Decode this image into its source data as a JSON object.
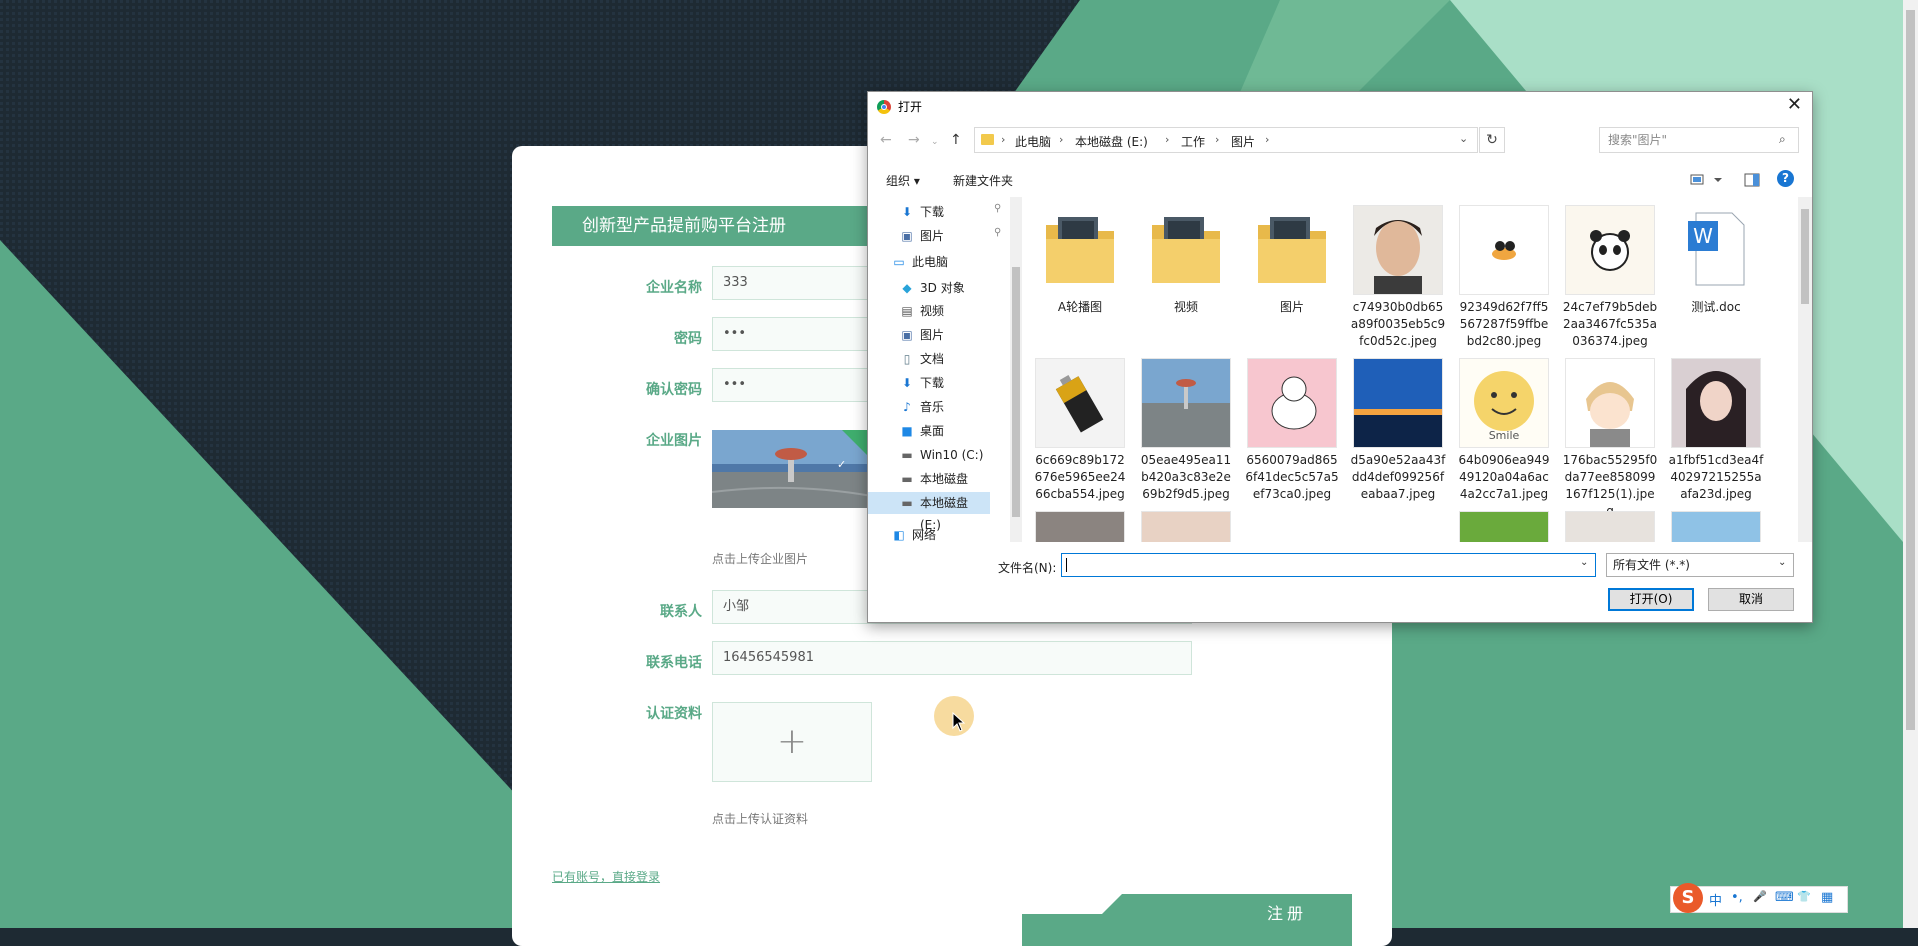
{
  "registration": {
    "title": "创新型产品提前购平台注册",
    "fields": [
      {
        "label": "企业名称",
        "value": "333"
      },
      {
        "label": "密码",
        "value": "•••"
      },
      {
        "label": "确认密码",
        "value": "•••"
      }
    ],
    "image_label": "企业图片",
    "image_hint": "点击上传企业图片",
    "contact_label": "联系人",
    "contact_value": "小邹",
    "phone_label": "联系电话",
    "phone_value": "16456545981",
    "cert_label": "认证资料",
    "cert_plus": "+",
    "cert_hint": "点击上传认证资料",
    "login_link": "已有账号，直接登录",
    "register_button": "注册"
  },
  "dialog": {
    "title": "打开",
    "close": "✕",
    "breadcrumbs": [
      "此电脑",
      "本地磁盘 (E:)",
      "工作",
      "图片"
    ],
    "search_placeholder": "搜索\"图片\"",
    "organize": "组织 ▾",
    "new_folder": "新建文件夹",
    "help": "?",
    "tree": [
      {
        "label": "下载",
        "icon": "download-icon",
        "glyph": "⬇",
        "color": "#1976d2",
        "indent": 1
      },
      {
        "label": "图片",
        "icon": "pictures-icon",
        "glyph": "▣",
        "color": "#4a6fa5",
        "indent": 1
      },
      {
        "label": "此电脑",
        "icon": "computer-icon",
        "glyph": "▭",
        "color": "#1e88e5",
        "indent": 0
      },
      {
        "label": "3D 对象",
        "icon": "cube-icon",
        "glyph": "◆",
        "color": "#29a3d9",
        "indent": 1
      },
      {
        "label": "视频",
        "icon": "video-icon",
        "glyph": "▤",
        "color": "#555555",
        "indent": 1
      },
      {
        "label": "图片",
        "icon": "pictures-icon",
        "glyph": "▣",
        "color": "#4a6fa5",
        "indent": 1
      },
      {
        "label": "文档",
        "icon": "document-icon",
        "glyph": "▯",
        "color": "#607d8b",
        "indent": 1
      },
      {
        "label": "下载",
        "icon": "download-icon",
        "glyph": "⬇",
        "color": "#1976d2",
        "indent": 1
      },
      {
        "label": "音乐",
        "icon": "music-icon",
        "glyph": "♪",
        "color": "#1976d2",
        "indent": 1
      },
      {
        "label": "桌面",
        "icon": "desktop-icon",
        "glyph": "■",
        "color": "#1e88e5",
        "indent": 1
      },
      {
        "label": "Win10 (C:)",
        "icon": "drive-icon",
        "glyph": "▬",
        "color": "#666666",
        "indent": 1
      },
      {
        "label": "本地磁盘 (D:)",
        "icon": "drive-icon",
        "glyph": "▬",
        "color": "#666666",
        "indent": 1
      },
      {
        "label": "本地磁盘 (E:)",
        "icon": "drive-icon",
        "glyph": "▬",
        "color": "#666666",
        "indent": 1,
        "selected": true
      },
      {
        "label": "网络",
        "icon": "network-icon",
        "glyph": "◧",
        "color": "#1e88e5",
        "indent": 0
      }
    ],
    "files": [
      {
        "name": "A轮播图",
        "kind": "folder"
      },
      {
        "name": "视频",
        "kind": "folder"
      },
      {
        "name": "图片",
        "kind": "folder"
      },
      {
        "name": "c74930b0db65a89f0035eb5c9fc0d52c.jpeg",
        "kind": "portrait"
      },
      {
        "name": "92349d62f7ff5567287f59ffbebd2c80.jpeg",
        "kind": "sticker"
      },
      {
        "name": "24c7ef79b5deb2aa3467fc535a036374.jpeg",
        "kind": "panda"
      },
      {
        "name": "测试.doc",
        "kind": "doc"
      },
      {
        "name": "6c669c89b172676e5965ee2466cba554.jpeg",
        "kind": "battery"
      },
      {
        "name": "05eae495ea11b420a3c83e2e69b2f9d5.jpeg",
        "kind": "landscape"
      },
      {
        "name": "6560079ad8656f41dec5c57a5ef73ca0.jpeg",
        "kind": "pink"
      },
      {
        "name": "d5a90e52aa43fdd4def099256feabaa7.jpeg",
        "kind": "sunset"
      },
      {
        "name": "64b0906ea94949120a04a6ac4a2cc7a1.jpeg",
        "kind": "smile"
      },
      {
        "name": "176bac55295f0da77ee858099167f125(1).jpeg",
        "kind": "anime"
      },
      {
        "name": "a1fbf51cd3ea4f40297215255aafa23d.jpeg",
        "kind": "girl"
      }
    ],
    "filename_label": "文件名(N):",
    "filename_value": "",
    "filetype": "所有文件 (*.*)",
    "open_button": "打开(O)",
    "cancel_button": "取消"
  },
  "ime": {
    "logo": "S",
    "items": [
      "中",
      "•,",
      "🎤",
      "⌨",
      "👕",
      "▦"
    ]
  },
  "colors": {
    "brand": "#5aa987",
    "dark_bg": "#1e2a33",
    "accent_blue": "#0078d7"
  }
}
